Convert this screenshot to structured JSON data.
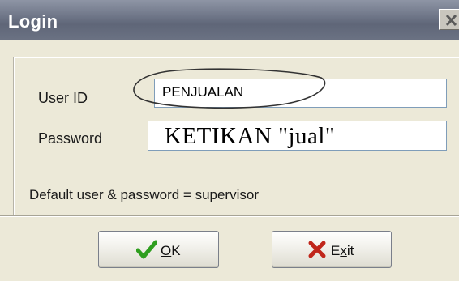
{
  "window": {
    "title": "Login"
  },
  "form": {
    "userid_label": "User ID",
    "userid_value": "PENJUALAN",
    "password_label": "Password",
    "password_annotation": "KETIKAN \"jual\"",
    "hint": "Default user & password = supervisor"
  },
  "buttons": {
    "ok_label_rest": "K",
    "ok_mnemonic": "O",
    "exit_label_start": "E",
    "exit_mnemonic": "x",
    "exit_label_end": "it"
  },
  "icons": {
    "ok": "check-icon",
    "exit": "cross-icon",
    "close": "close-icon"
  },
  "colors": {
    "titlebar": "#6f7688",
    "window_bg": "#ece9d8",
    "check_green": "#2f9e1f",
    "cross_red": "#c0261b",
    "annotation_stroke": "#333333"
  }
}
